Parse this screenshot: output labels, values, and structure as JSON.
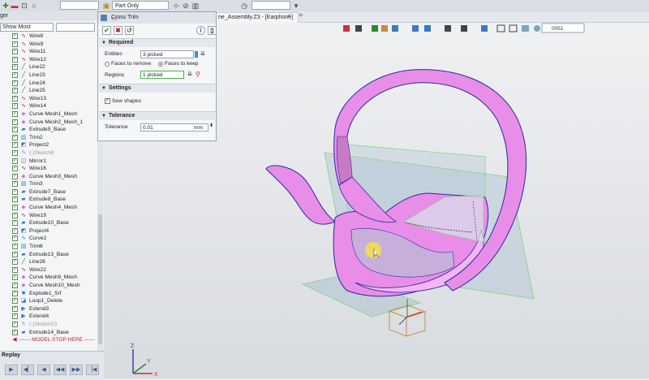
{
  "toolbar": {
    "part_filter": "Part Only",
    "coord": "0051"
  },
  "tabs": {
    "active": "ne_Assembly.Z3 - [Earphone]",
    "close": "×",
    "add": "+"
  },
  "left_panel": {
    "header": "ger",
    "filter": "Show Most",
    "tree": [
      {
        "label": "Wire8",
        "icon": "wire"
      },
      {
        "label": "Wire9",
        "icon": "wire"
      },
      {
        "label": "Wire11",
        "icon": "wire"
      },
      {
        "label": "Wire12",
        "icon": "wire"
      },
      {
        "label": "Line22",
        "icon": "line"
      },
      {
        "label": "Line23",
        "icon": "line"
      },
      {
        "label": "Line24",
        "icon": "line"
      },
      {
        "label": "Line25",
        "icon": "line"
      },
      {
        "label": "Wire13",
        "icon": "wire"
      },
      {
        "label": "Wire14",
        "icon": "wire"
      },
      {
        "label": "Curve Mesh1_Mesh",
        "icon": "mesh"
      },
      {
        "label": "Curve Mesh2_Mesh_1",
        "icon": "mesh"
      },
      {
        "label": "Extrude5_Base",
        "icon": "extrude"
      },
      {
        "label": "Trim2",
        "icon": "trim"
      },
      {
        "label": "Project2",
        "icon": "project"
      },
      {
        "label": "(-)Sketch8",
        "icon": "sketch"
      },
      {
        "label": "Mirror1",
        "icon": "mirror"
      },
      {
        "label": "Wire16",
        "icon": "wire"
      },
      {
        "label": "Curve Mesh3_Mesh",
        "icon": "mesh"
      },
      {
        "label": "Trim3",
        "icon": "trim"
      },
      {
        "label": "Extrude7_Base",
        "icon": "extrude"
      },
      {
        "label": "Extrude8_Base",
        "icon": "extrude"
      },
      {
        "label": "Curve Mesh4_Mesh",
        "icon": "mesh"
      },
      {
        "label": "Wire19",
        "icon": "wire"
      },
      {
        "label": "Extrude10_Base",
        "icon": "extrude"
      },
      {
        "label": "Project4",
        "icon": "project"
      },
      {
        "label": "Curve2",
        "icon": "curve"
      },
      {
        "label": "Trim6",
        "icon": "trim"
      },
      {
        "label": "Extrude13_Base",
        "icon": "extrude"
      },
      {
        "label": "Line26",
        "icon": "line"
      },
      {
        "label": "Wire22",
        "icon": "wire"
      },
      {
        "label": "Curve Mesh9_Mesh",
        "icon": "mesh"
      },
      {
        "label": "Curve Mesh10_Mesh",
        "icon": "mesh"
      },
      {
        "label": "Explode1_Srf",
        "icon": "explode"
      },
      {
        "label": "Loop1_Delete",
        "icon": "delete"
      },
      {
        "label": "Extend3",
        "icon": "extend"
      },
      {
        "label": "Extend4",
        "icon": "extend"
      },
      {
        "label": "(-)Sketch10",
        "icon": "sketch"
      },
      {
        "label": "Extrude14_Base",
        "icon": "extrude"
      }
    ],
    "model_stop": "------ MODEL STOP HERE ------"
  },
  "replay": {
    "title": "Replay"
  },
  "dialog": {
    "title": "Cross Trim",
    "required": "Required",
    "entities_label": "Entities",
    "entities_value": "3 picked",
    "faces_remove": "Faces to remove",
    "faces_keep": "Faces to keep",
    "regions_label": "Regions",
    "regions_value": "1 picked",
    "settings": "Settings",
    "sew_shapes": "Sew shapes",
    "tolerance_section": "Tolerance",
    "tolerance_label": "Tolerance",
    "tolerance_value": "0.01",
    "tolerance_unit": "mm"
  },
  "axes": {
    "x": "X",
    "y": "Y",
    "z": "Z"
  },
  "colors": {
    "surface": "#e88ee8",
    "edge": "#2a2a9a",
    "plane": "#8aa8bf",
    "accent": "#3c8fe0"
  }
}
